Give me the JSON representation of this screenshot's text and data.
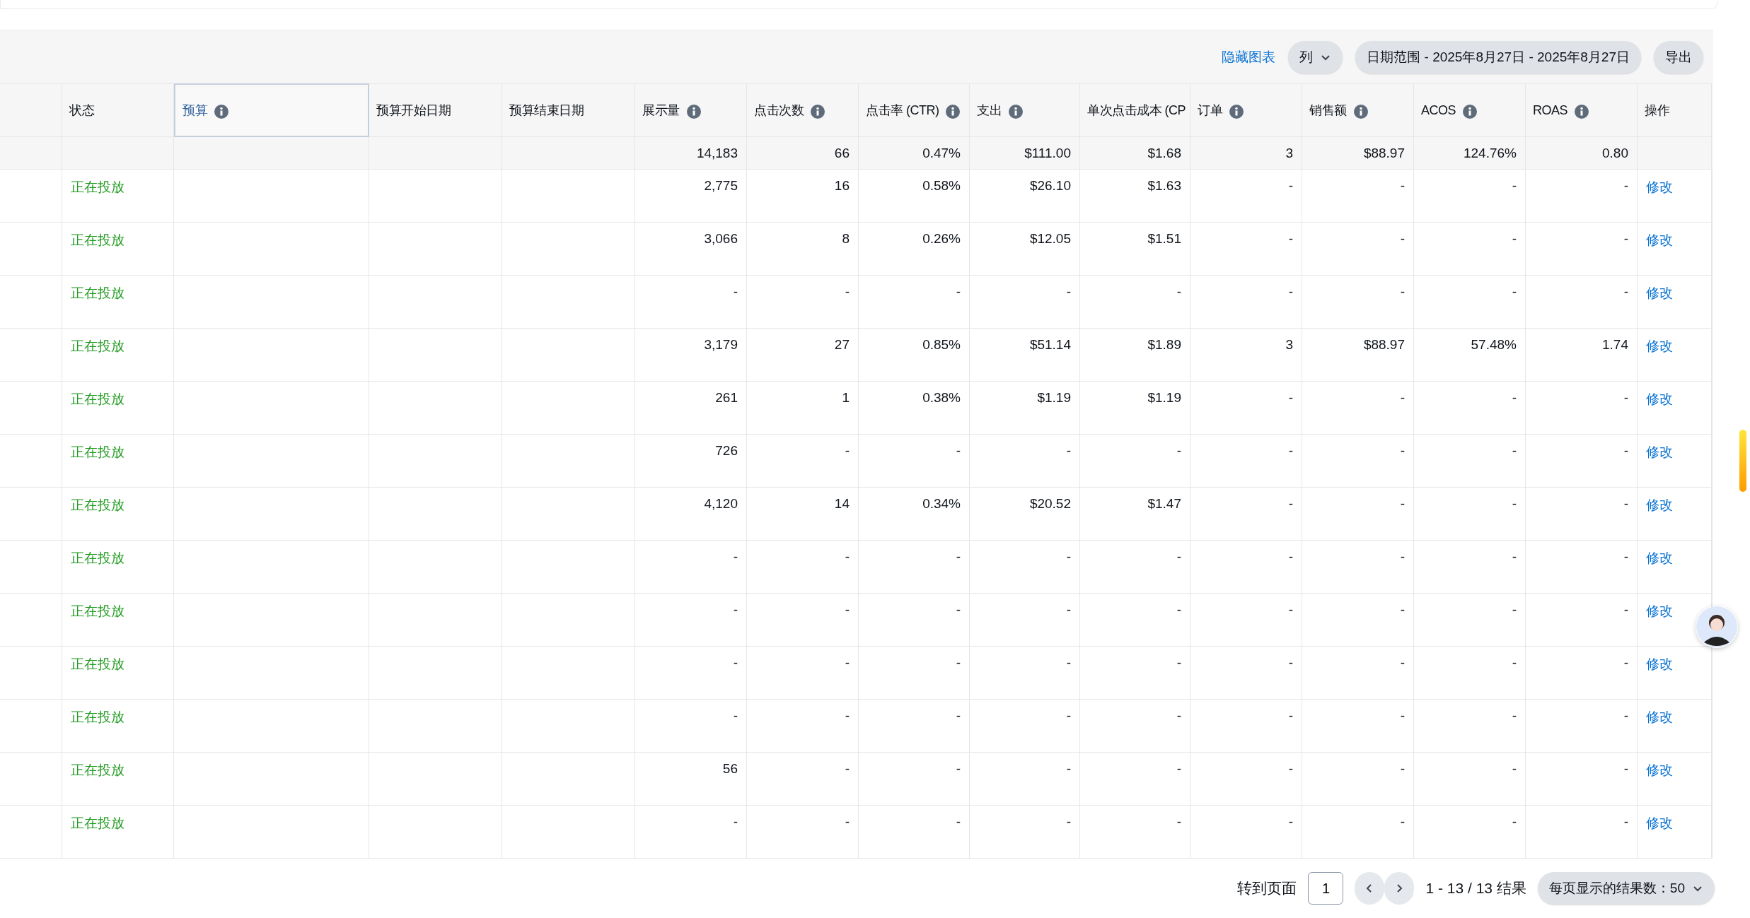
{
  "toolbar": {
    "hide_chart_link": "隐藏图表",
    "columns_button": "列",
    "date_range_button": "日期范围 - 2025年8月27日 - 2025年8月27日",
    "export_button": "导出"
  },
  "table": {
    "columns": [
      {
        "label": "状态",
        "info": false,
        "selected": false
      },
      {
        "label": "预算",
        "info": true,
        "selected": true
      },
      {
        "label": "预算开始日期",
        "info": false,
        "selected": false
      },
      {
        "label": "预算结束日期",
        "info": false,
        "selected": false
      },
      {
        "label": "展示量",
        "info": true,
        "selected": false
      },
      {
        "label": "点击次数",
        "info": true,
        "selected": false
      },
      {
        "label": "点击率 (CTR)",
        "info": true,
        "selected": false
      },
      {
        "label": "支出",
        "info": true,
        "selected": false
      },
      {
        "label": "单次点击成本 (CP",
        "info": false,
        "selected": false
      },
      {
        "label": "订单",
        "info": true,
        "selected": false
      },
      {
        "label": "销售额",
        "info": true,
        "selected": false
      },
      {
        "label": "ACOS",
        "info": true,
        "selected": false
      },
      {
        "label": "ROAS",
        "info": true,
        "selected": false
      },
      {
        "label": "操作",
        "info": false,
        "selected": false
      }
    ],
    "summary": [
      "14,183",
      "66",
      "0.47%",
      "$111.00",
      "$1.68",
      "3",
      "$88.97",
      "124.76%",
      "0.80"
    ],
    "rows": [
      {
        "status": "正在投放",
        "metrics": [
          "2,775",
          "16",
          "0.58%",
          "$26.10",
          "$1.63",
          "-",
          "-",
          "-",
          "-"
        ],
        "action": "修改"
      },
      {
        "status": "正在投放",
        "metrics": [
          "3,066",
          "8",
          "0.26%",
          "$12.05",
          "$1.51",
          "-",
          "-",
          "-",
          "-"
        ],
        "action": "修改"
      },
      {
        "status": "正在投放",
        "metrics": [
          "-",
          "-",
          "-",
          "-",
          "-",
          "-",
          "-",
          "-",
          "-"
        ],
        "action": "修改"
      },
      {
        "status": "正在投放",
        "metrics": [
          "3,179",
          "27",
          "0.85%",
          "$51.14",
          "$1.89",
          "3",
          "$88.97",
          "57.48%",
          "1.74"
        ],
        "action": "修改"
      },
      {
        "status": "正在投放",
        "metrics": [
          "261",
          "1",
          "0.38%",
          "$1.19",
          "$1.19",
          "-",
          "-",
          "-",
          "-"
        ],
        "action": "修改"
      },
      {
        "status": "正在投放",
        "metrics": [
          "726",
          "-",
          "-",
          "-",
          "-",
          "-",
          "-",
          "-",
          "-"
        ],
        "action": "修改"
      },
      {
        "status": "正在投放",
        "metrics": [
          "4,120",
          "14",
          "0.34%",
          "$20.52",
          "$1.47",
          "-",
          "-",
          "-",
          "-"
        ],
        "action": "修改"
      },
      {
        "status": "正在投放",
        "metrics": [
          "-",
          "-",
          "-",
          "-",
          "-",
          "-",
          "-",
          "-",
          "-"
        ],
        "action": "修改"
      },
      {
        "status": "正在投放",
        "metrics": [
          "-",
          "-",
          "-",
          "-",
          "-",
          "-",
          "-",
          "-",
          "-"
        ],
        "action": "修改"
      },
      {
        "status": "正在投放",
        "metrics": [
          "-",
          "-",
          "-",
          "-",
          "-",
          "-",
          "-",
          "-",
          "-"
        ],
        "action": "修改"
      },
      {
        "status": "正在投放",
        "metrics": [
          "-",
          "-",
          "-",
          "-",
          "-",
          "-",
          "-",
          "-",
          "-"
        ],
        "action": "修改"
      },
      {
        "status": "正在投放",
        "metrics": [
          "56",
          "-",
          "-",
          "-",
          "-",
          "-",
          "-",
          "-",
          "-"
        ],
        "action": "修改"
      },
      {
        "status": "正在投放",
        "metrics": [
          "-",
          "-",
          "-",
          "-",
          "-",
          "-",
          "-",
          "-",
          "-"
        ],
        "action": "修改"
      }
    ]
  },
  "pagination": {
    "goto_label": "转到页面",
    "page_input": "1",
    "results": "1 - 13 / 13 结果",
    "per_page": "每页显示的结果数：50"
  }
}
